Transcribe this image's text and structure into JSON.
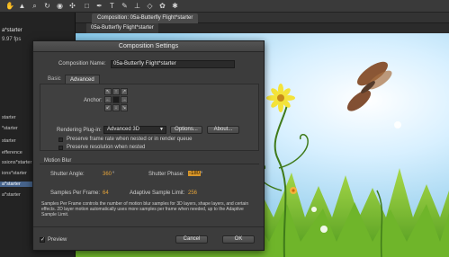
{
  "app": {
    "panel_title": "a*starter",
    "fps": "9.97 fps",
    "panel_items": [
      "starter",
      "*starter",
      "starter",
      "efference",
      "ssions*starter",
      "ions*starter",
      "a*starter",
      "a*starter"
    ],
    "selected_item_index": 6,
    "comp_tab": "Composition: 05a-Butterfly Flight*starter",
    "comp_subtab": "05a-Butterfly Flight*starter"
  },
  "dialog": {
    "title": "Composition Settings",
    "comp_name_label": "Composition Name:",
    "comp_name_value": "05a-Butterfly Flight*starter",
    "tabs": [
      "Basic",
      "Advanced"
    ],
    "active_tab": "Advanced",
    "anchor_label": "Anchor:",
    "anchor_arrows": [
      "↖",
      "↑",
      "↗",
      "←",
      "",
      "→",
      "↙",
      "↓",
      "↘"
    ],
    "render_plugin_label": "Rendering Plug-in:",
    "render_plugin_value": "Advanced 3D",
    "options_button": "Options...",
    "about_button": "About...",
    "preserve_frame_rate": "Preserve frame rate when nested or in render queue",
    "preserve_resolution": "Preserve resolution when nested",
    "motion_blur_label": "Motion Blur",
    "shutter_angle_label": "Shutter Angle:",
    "shutter_angle_value": "360",
    "shutter_angle_unit": "°",
    "shutter_phase_label": "Shutter Phase:",
    "shutter_phase_value": "-180",
    "shutter_phase_unit": "°",
    "samples_per_frame_label": "Samples Per Frame:",
    "samples_per_frame_value": "64",
    "adaptive_limit_label": "Adaptive Sample Limit:",
    "adaptive_limit_value": "256",
    "note": "Samples Per Frame controls the number of motion blur samples for 3D layers, shape layers, and certain effects. 2D layer motion automatically uses more samples per frame when needed, up to the Adaptive Sample Limit.",
    "preview_label": "Preview",
    "preview_checked": "✓",
    "cancel_button": "Cancel",
    "ok_button": "OK"
  },
  "colors": {
    "highlight": "#d8962a",
    "value_orange": "#e5a43a"
  }
}
